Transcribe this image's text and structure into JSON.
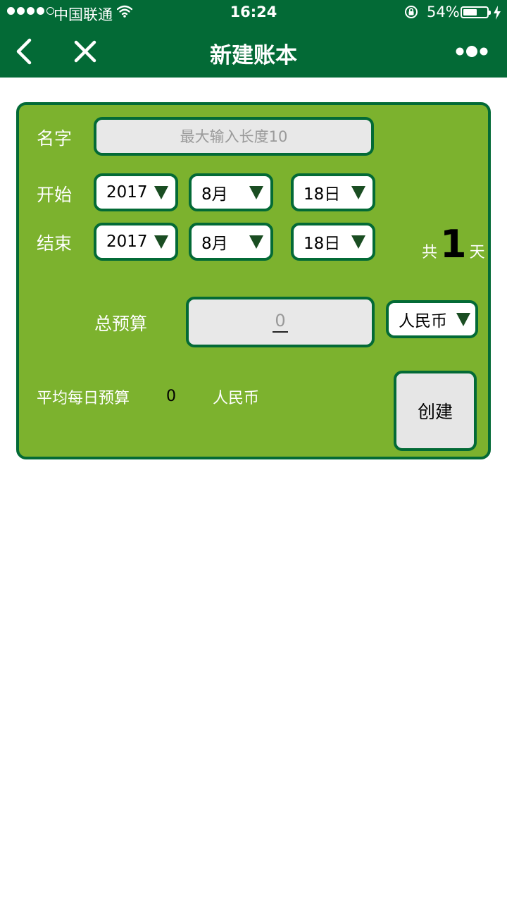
{
  "status_bar": {
    "carrier": "中国联通",
    "time": "16:24",
    "battery": "54%",
    "battery_level": 0.54
  },
  "nav": {
    "title": "新建账本",
    "back_icon": "chevron-left-icon",
    "close_icon": "close-icon",
    "more_icon": "more-dots-icon"
  },
  "form": {
    "name_label": "名字",
    "name_placeholder": "最大输入长度10",
    "start_label": "开始",
    "end_label": "结束",
    "start": {
      "year": "2017",
      "month": "8月",
      "day": "18日"
    },
    "end": {
      "year": "2017",
      "month": "8月",
      "day": "18日"
    },
    "days_prefix": "共",
    "days_count": "1",
    "days_suffix": "天",
    "budget_label": "总预算",
    "budget_value": "0",
    "currency": "人民币",
    "avg_label": "平均每日预算",
    "avg_value": "0",
    "avg_currency": "人民币",
    "create_label": "创建"
  },
  "colors": {
    "header": "#036a36",
    "card": "#7cb22e",
    "border": "#036a36"
  }
}
